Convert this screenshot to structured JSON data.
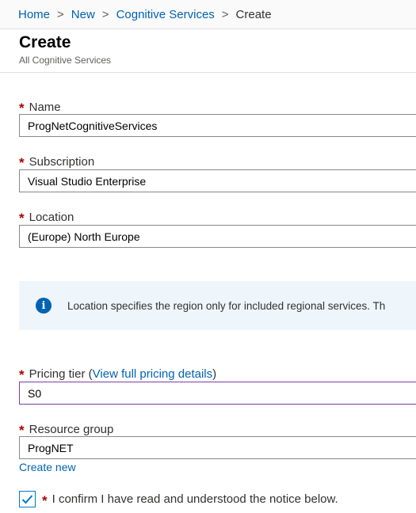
{
  "breadcrumb": {
    "items": [
      "Home",
      "New",
      "Cognitive Services"
    ],
    "current": "Create",
    "separator": ">"
  },
  "header": {
    "title": "Create",
    "subtitle": "All Cognitive Services"
  },
  "form": {
    "required_marker": "*",
    "name": {
      "label": "Name",
      "value": "ProgNetCognitiveServices"
    },
    "subscription": {
      "label": "Subscription",
      "value": "Visual Studio Enterprise"
    },
    "location": {
      "label": "Location",
      "value": "(Europe) North Europe"
    },
    "info": {
      "icon": "info-icon",
      "text": "Location specifies the region only for included regional services. Th"
    },
    "pricing_tier": {
      "label": "Pricing tier",
      "paren_open": " (",
      "link": "View full pricing details",
      "paren_close": ")",
      "value": "S0"
    },
    "resource_group": {
      "label": "Resource group",
      "value": "ProgNET",
      "create_new": "Create new"
    },
    "confirm": {
      "checked": true,
      "text": "I confirm I have read and understood the notice below."
    }
  },
  "colors": {
    "link": "#0063b1",
    "required": "#a80000",
    "focus_border": "#7a3e9d",
    "info_background": "#eef6fc"
  }
}
